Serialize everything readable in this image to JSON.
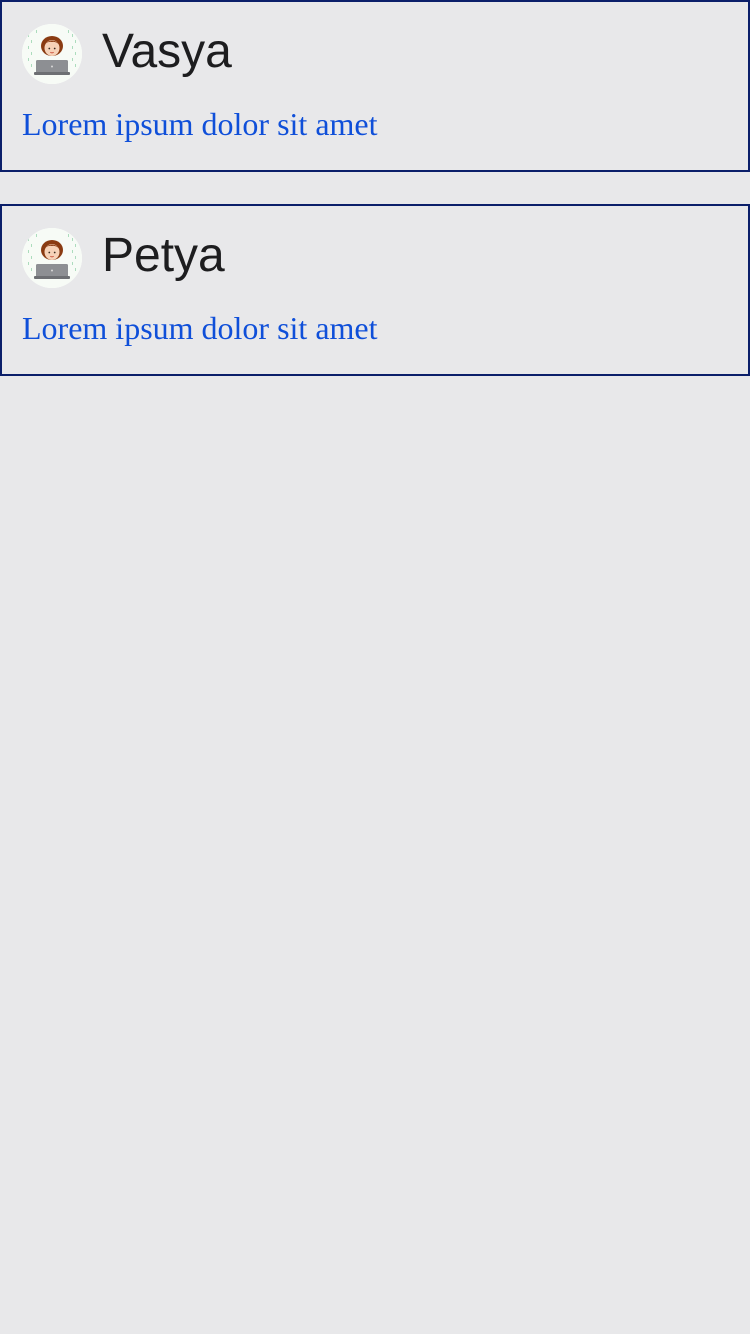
{
  "cards": [
    {
      "name": "Vasya",
      "message": "Lorem ipsum dolor sit amet",
      "avatar_icon": "avatar-person-laptop-icon"
    },
    {
      "name": "Petya",
      "message": "Lorem ipsum dolor sit amet",
      "avatar_icon": "avatar-person-laptop-icon"
    }
  ],
  "colors": {
    "page_background": "#e8e8ea",
    "card_border": "#0b1f6a",
    "name_text": "#1d1d1f",
    "message_text": "#0f4fd9"
  }
}
